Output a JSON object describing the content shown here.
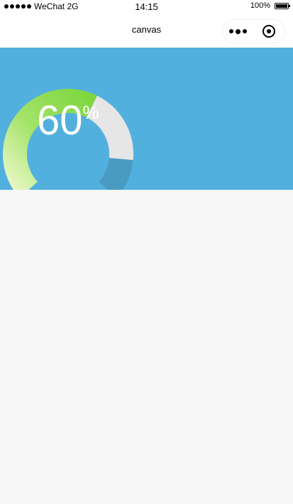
{
  "status_bar": {
    "carrier": "WeChat 2G",
    "time": "14:15",
    "battery": "100%"
  },
  "nav": {
    "title": "canvas"
  },
  "gauge": {
    "value": "60",
    "unit": "%",
    "fraction": 0.6,
    "colors": {
      "background": "#52b0de",
      "progress": "#86dd4c",
      "remaining": "#e6e6e6",
      "track_tail": "#4a9bc2"
    }
  }
}
